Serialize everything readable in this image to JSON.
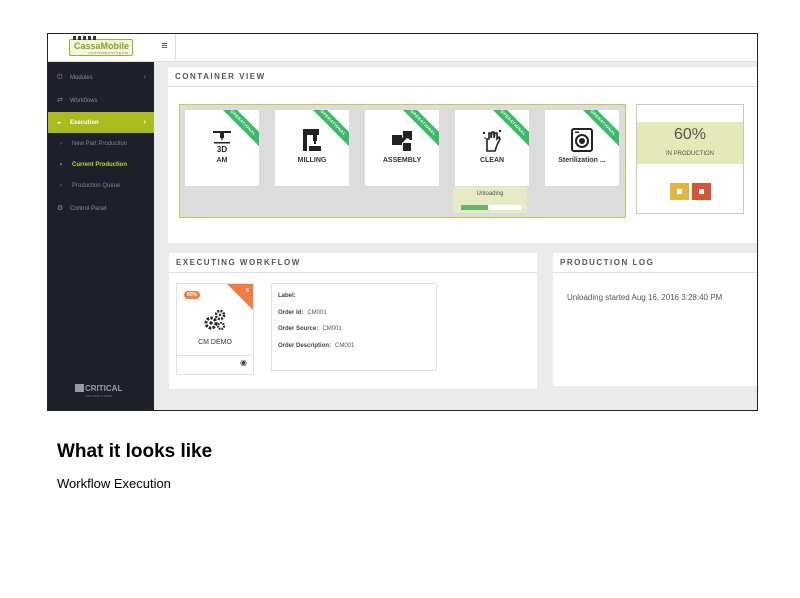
{
  "app": {
    "logo_text": "CassaMobile",
    "logo_subtext": "A SOFTWARE FOR THE FAB",
    "menu_icon": "hamburger-icon"
  },
  "sidebar": {
    "items": [
      {
        "label": "Modules",
        "icon": "power-icon",
        "chevron": "›"
      },
      {
        "label": "Workflows",
        "icon": "shuffle-icon"
      },
      {
        "label": "Execution",
        "icon": "dashboard-icon",
        "chevron": "›"
      }
    ],
    "subitems": [
      {
        "label": "New Part Production"
      },
      {
        "label": "Current Production"
      },
      {
        "label": "Production Queue"
      }
    ],
    "control_panel": {
      "label": "Control Panel",
      "icon": "gear-icon"
    },
    "footer_logo": "CRITICAL",
    "footer_sub": "MANUFACTURING"
  },
  "container_view": {
    "title": "CONTAINER VIEW",
    "stations": [
      {
        "label": "AM",
        "badge": "OPERATIONAL",
        "icon": "3d-printer-icon"
      },
      {
        "label": "MILLING",
        "badge": "OPERATIONAL",
        "icon": "milling-machine-icon"
      },
      {
        "label": "ASSEMBLY",
        "badge": "OPERATIONAL",
        "icon": "puzzle-icon"
      },
      {
        "label": "CLEAN",
        "badge": "OPERATIONAL",
        "icon": "clean-hand-icon",
        "status": "Unloading",
        "progress": 0.45
      },
      {
        "label": "Sterilization ...",
        "badge": "OPERATIONAL",
        "icon": "sterilization-icon"
      }
    ],
    "production": {
      "percent": "60%",
      "label": "IN PRODUCTION",
      "pause_icon": "pause-icon",
      "stop_icon": "stop-icon"
    }
  },
  "executing_workflow": {
    "title": "EXECUTING WORKFLOW",
    "card": {
      "badge": "60%",
      "corner": "6",
      "name": "CM DEMO",
      "icon": "gears-icon",
      "view_icon": "eye-icon"
    },
    "details": [
      {
        "label": "Label:",
        "value": ""
      },
      {
        "label": "Order Id:",
        "value": "CM001"
      },
      {
        "label": "Order Source:",
        "value": "CM001"
      },
      {
        "label": "Order Description:",
        "value": "CM001"
      }
    ]
  },
  "production_log": {
    "title": "PRODUCTION LOG",
    "entries": [
      "Unloading started Aug 16, 2016 3:28:40 PM"
    ]
  },
  "caption": {
    "title": "What it looks like",
    "subtitle": "Workflow Execution"
  },
  "colors": {
    "sidebar_bg": "#1d1f2b",
    "accent": "#a9bb1f",
    "operational": "#3cb96a",
    "badge": "#f07c48",
    "pause": "#e3b43e",
    "stop": "#d95436"
  }
}
